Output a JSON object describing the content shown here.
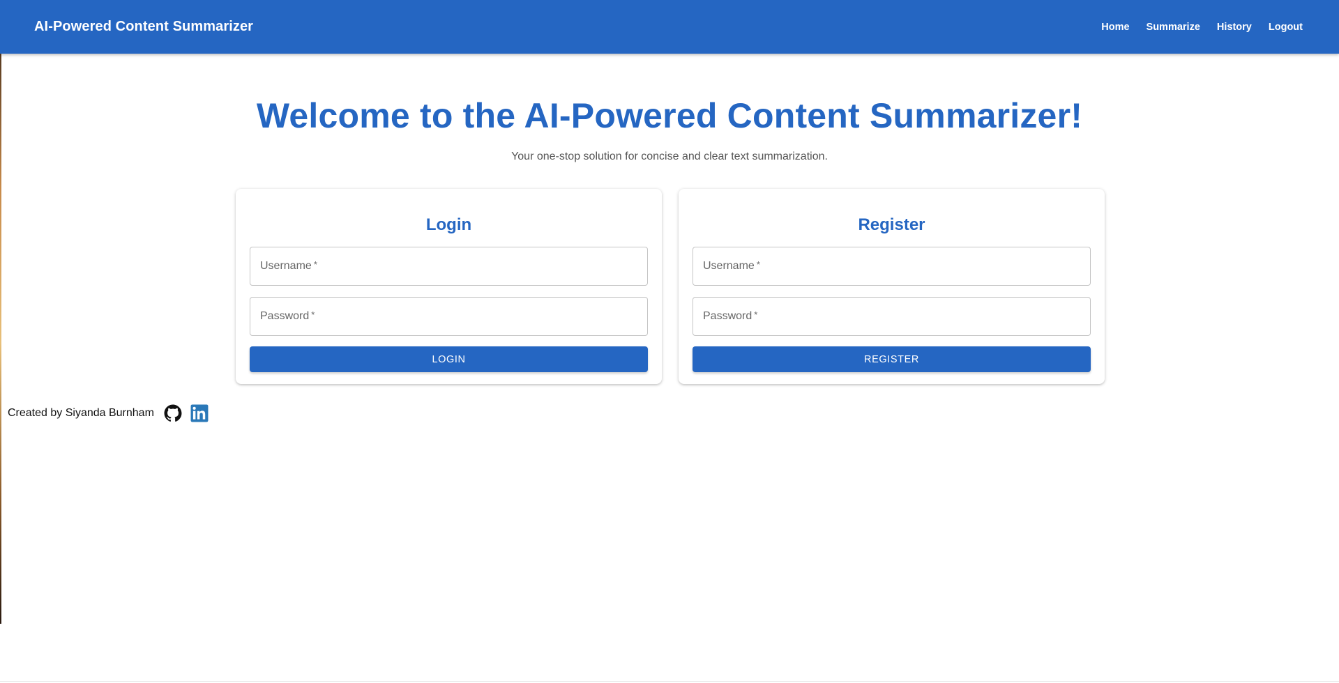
{
  "header": {
    "brand": "AI-Powered Content Summarizer",
    "nav": [
      "Home",
      "Summarize",
      "History",
      "Logout"
    ]
  },
  "hero": {
    "title": "Welcome to the AI-Powered Content Summarizer!",
    "subtitle": "Your one-stop solution for concise and clear text summarization."
  },
  "login": {
    "title": "Login",
    "username_label": "Username",
    "password_label": "Password",
    "required_mark": "*",
    "button": "LOGIN"
  },
  "register": {
    "title": "Register",
    "username_label": "Username",
    "password_label": "Password",
    "required_mark": "*",
    "button": "REGISTER"
  },
  "footer": {
    "credit": "Created by Siyanda Burnham",
    "icons": [
      "github-icon",
      "linkedin-icon"
    ]
  },
  "colors": {
    "primary": "#2566c2",
    "linkedin": "#2a78b8"
  }
}
